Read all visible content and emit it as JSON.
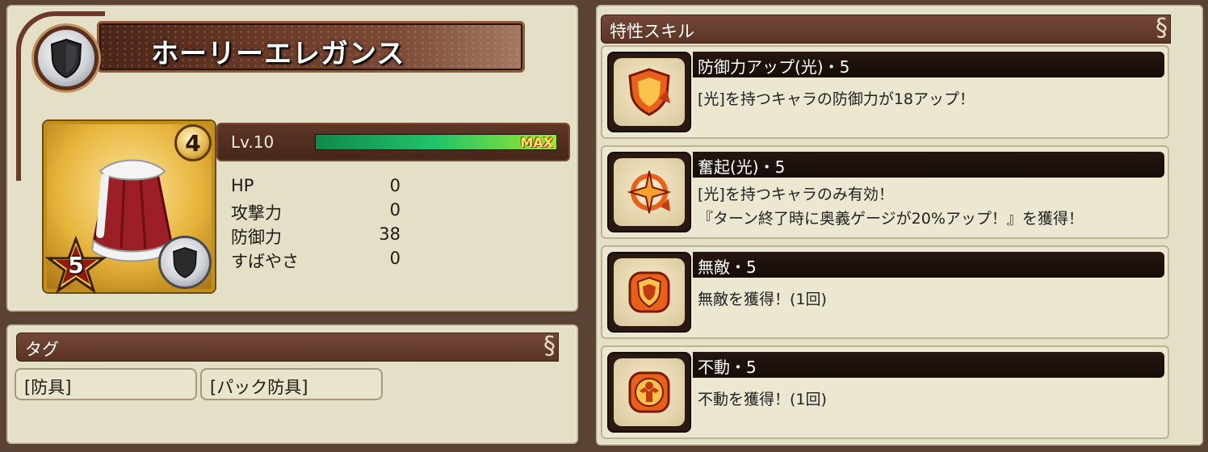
{
  "item": {
    "name": "ホーリーエレガンス",
    "rarity_number": "4",
    "stars": "5"
  },
  "level": {
    "label": "Lv.10",
    "max_badge": "MAX",
    "progress": 1.0
  },
  "stats": [
    {
      "label": "HP",
      "value": "0"
    },
    {
      "label": "攻撃力",
      "value": "0"
    },
    {
      "label": "防御力",
      "value": "38"
    },
    {
      "label": "すばやさ",
      "value": "0"
    }
  ],
  "tags": {
    "header": "タグ",
    "items": [
      "[防具]",
      "[パック防具]"
    ]
  },
  "skills": {
    "header": "特性スキル",
    "items": [
      {
        "title": "防御力アップ(光)・5",
        "desc": [
          "[光]を持つキャラの防御力が18アップ！"
        ],
        "icon": "shield-up-icon"
      },
      {
        "title": "奮起(光)・5",
        "desc": [
          "[光]を持つキャラのみ有効！",
          "『ターン終了時に奥義ゲージが20%アップ！』を獲得！"
        ],
        "icon": "rally-icon"
      },
      {
        "title": "無敵・5",
        "desc": [
          "無敵を獲得！(1回)"
        ],
        "icon": "invincible-icon"
      },
      {
        "title": "不動・5",
        "desc": [
          "不動を獲得！(1回)"
        ],
        "icon": "immovable-icon"
      }
    ]
  },
  "colors": {
    "panel": "#e4e0c7",
    "header": "#6a3e2e",
    "accent_gold": "#e3b446",
    "skill_orange": "#e8601a"
  }
}
